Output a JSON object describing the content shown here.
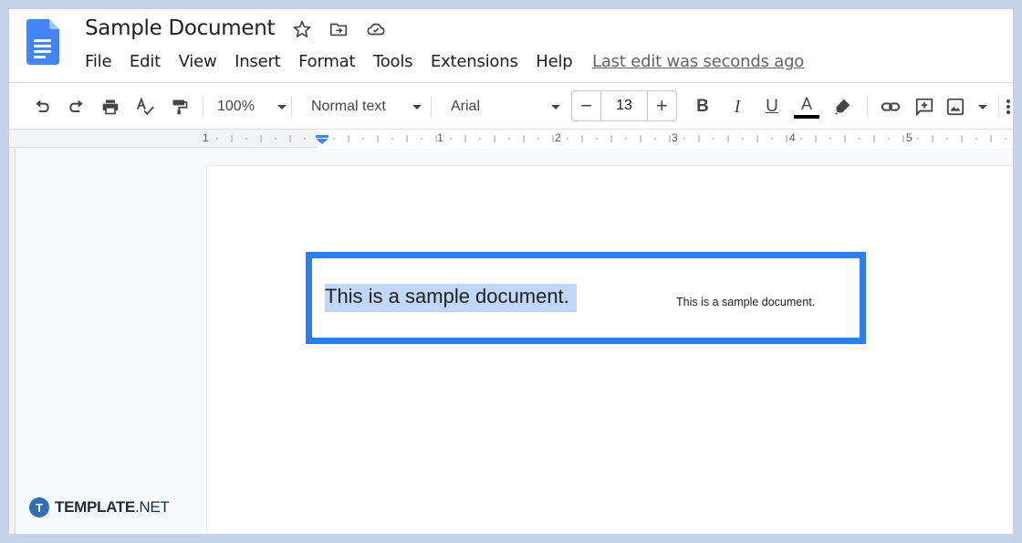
{
  "document": {
    "title": "Sample Document",
    "last_edit": "Last edit was seconds ago"
  },
  "header_icons": [
    "star-icon",
    "move-to-folder-icon",
    "cloud-saved-icon"
  ],
  "menu": [
    "File",
    "Edit",
    "View",
    "Insert",
    "Format",
    "Tools",
    "Extensions",
    "Help"
  ],
  "toolbar": {
    "zoom": "100%",
    "style": "Normal text",
    "font": "Arial",
    "font_size": "13",
    "decrease_label": "−",
    "increase_label": "+",
    "bold": "B",
    "italic": "I",
    "underline": "U",
    "text_color": "A"
  },
  "ruler": {
    "numbers": [
      "1",
      "1",
      "2",
      "3",
      "4",
      "5"
    ]
  },
  "content": {
    "selected_text": "This is a sample document.",
    "small_text": "This is a sample document."
  },
  "watermark": {
    "icon_letter": "T",
    "brand": "TEMPLATE",
    "suffix": ".NET"
  },
  "colors": {
    "accent_blue": "#2d7ff0",
    "selection": "#c2d6f7",
    "docs_blue": "#4285f4",
    "background": "#c5d3ea"
  }
}
